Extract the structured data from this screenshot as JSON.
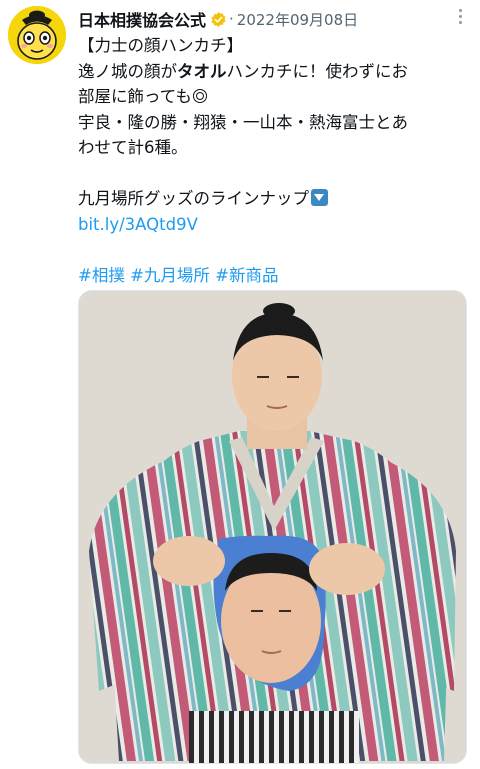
{
  "tweet": {
    "account_name": "日本相撲協会公式",
    "separator": "·",
    "date": "2022年09月08日",
    "lines": [
      "【力士の顔ハンカチ】",
      "逸ノ城の顔が",
      "タオル",
      "ハンカチに！使わずにお",
      "部屋に飾っても",
      "宇良・隆の勝・翔猿・一山本・熱海富士とあ",
      "わせて計6種。",
      "九月場所グッズのラインナップ",
      "bit.ly/3AQtd9V"
    ],
    "hashtags": [
      "#相撲",
      "#九月場所",
      "#新商品"
    ],
    "media": {
      "type": "photo",
      "alt": ""
    }
  },
  "icons": {
    "avatar": "mascot-avatar-icon",
    "verified": "verified-badge-icon",
    "more": "more-options-icon",
    "emoji_double_circle": "double-circle-emoji-icon",
    "emoji_arrow": "down-arrow-emoji-icon"
  },
  "colors": {
    "link": "#1d9bf0",
    "verified": "#f4c20d",
    "text": "#0f1419",
    "muted": "#536471",
    "avatar_bg": "#f5d60a"
  }
}
